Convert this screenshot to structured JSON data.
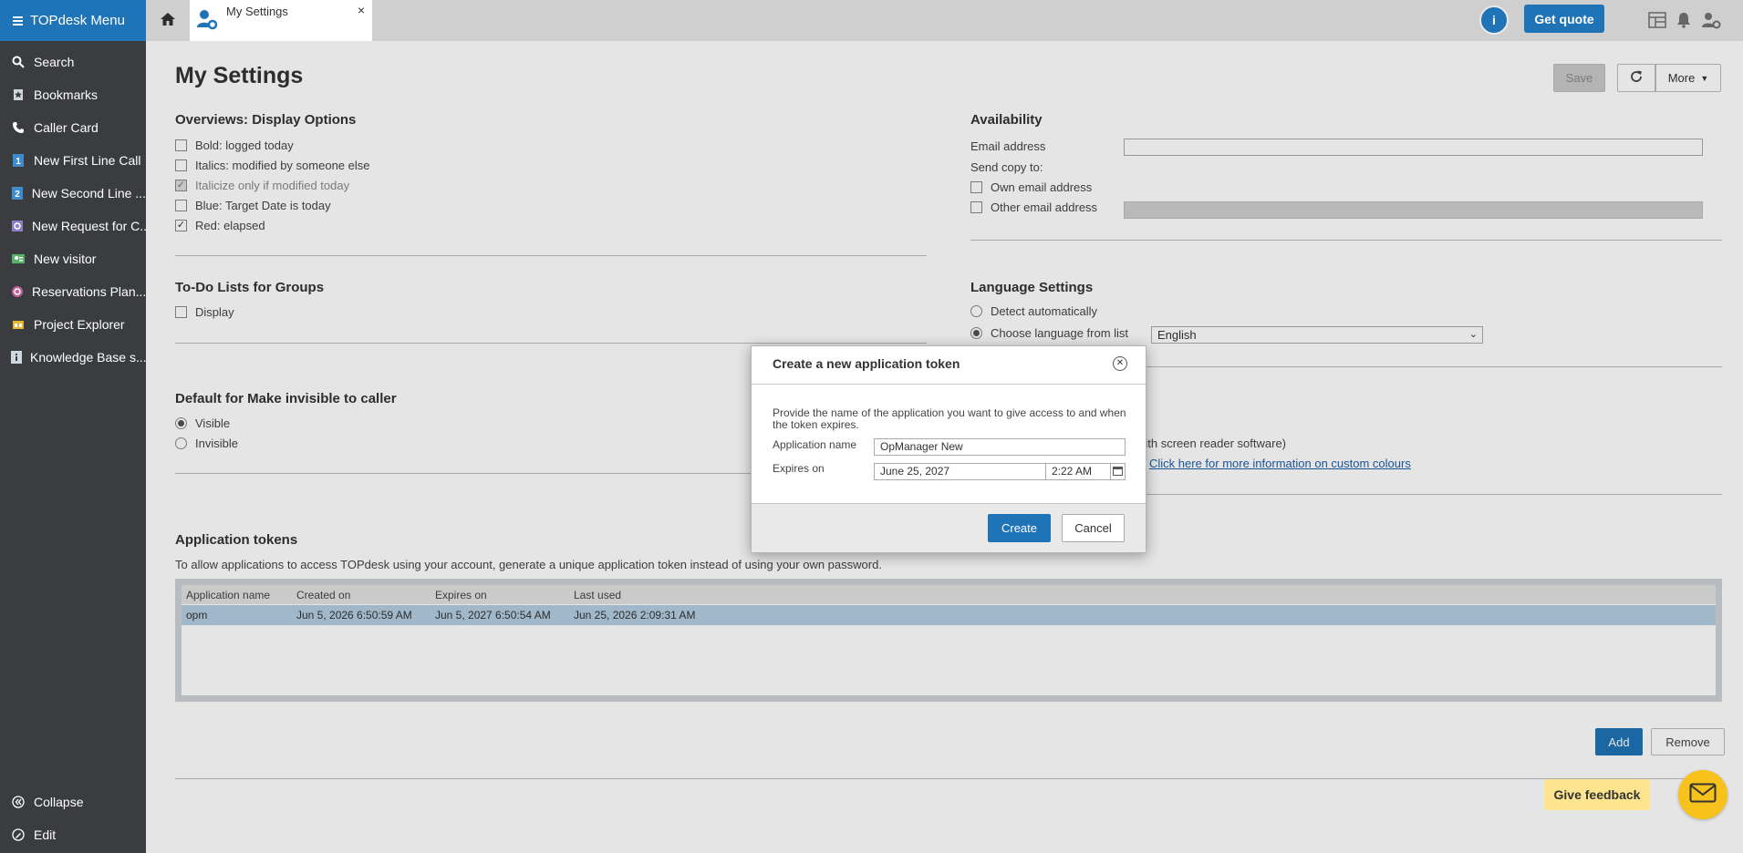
{
  "sidebar": {
    "menu_label": "TOPdesk Menu",
    "items": [
      {
        "label": "Search",
        "icon": "search-icon"
      },
      {
        "label": "Bookmarks",
        "icon": "bookmark-icon"
      },
      {
        "label": "Caller Card",
        "icon": "phone-icon"
      },
      {
        "label": "New First Line Call",
        "icon": "first-line-icon"
      },
      {
        "label": "New Second Line ...",
        "icon": "second-line-icon"
      },
      {
        "label": "New Request for C...",
        "icon": "change-request-icon"
      },
      {
        "label": "New visitor",
        "icon": "visitor-icon"
      },
      {
        "label": "Reservations Plan...",
        "icon": "reservations-icon"
      },
      {
        "label": "Project Explorer",
        "icon": "project-icon"
      },
      {
        "label": "Knowledge Base s...",
        "icon": "knowledge-icon"
      }
    ],
    "bottom": [
      {
        "label": "Collapse",
        "icon": "collapse-icon"
      },
      {
        "label": "Edit",
        "icon": "edit-icon"
      }
    ]
  },
  "topbar": {
    "tab_label": "My Settings",
    "tab_close": "×",
    "info_label": "i",
    "quote_label": "Get quote"
  },
  "page": {
    "title": "My Settings",
    "save_label": "Save",
    "more_label": "More"
  },
  "overviews": {
    "title": "Overviews: Display Options",
    "options": [
      {
        "label": "Bold: logged today",
        "checked": false,
        "disabled": false
      },
      {
        "label": "Italics: modified by someone else",
        "checked": false,
        "disabled": false
      },
      {
        "label": "Italicize only if modified today",
        "checked": true,
        "disabled": true
      },
      {
        "label": "Blue: Target Date is today",
        "checked": false,
        "disabled": false
      },
      {
        "label": "Red: elapsed",
        "checked": true,
        "disabled": false
      }
    ]
  },
  "todo": {
    "title": "To-Do Lists for Groups",
    "display_label": "Display"
  },
  "invisible": {
    "title": "Default for Make invisible to caller",
    "options": [
      "Visible",
      "Invisible"
    ],
    "selected": "Visible"
  },
  "availability": {
    "title": "Availability",
    "email_label": "Email address",
    "email_value": "",
    "send_copy_label": "Send copy to:",
    "own_email_label": "Own email address",
    "other_email_label": "Other email address"
  },
  "language": {
    "title": "Language Settings",
    "detect_label": "Detect automatically",
    "choose_label": "Choose language from list",
    "selected_language": "English"
  },
  "accessibility": {
    "screen_reader_text": "with screen reader software)",
    "custom_colours_link": "Click here for more information on custom colours"
  },
  "tokens": {
    "title": "Application tokens",
    "description": "To allow applications to access TOPdesk using your account, generate a unique application token instead of using your own password.",
    "columns": [
      "Application name",
      "Created on",
      "Expires on",
      "Last used"
    ],
    "rows": [
      [
        "opm",
        "Jun 5, 2026 6:50:59 AM",
        "Jun 5, 2027 6:50:54 AM",
        "Jun 25, 2026 2:09:31 AM"
      ]
    ],
    "add_label": "Add",
    "remove_label": "Remove"
  },
  "dialog": {
    "title": "Create a new application token",
    "description": "Provide the name of the application you want to give access to and when the token expires.",
    "app_name_label": "Application name",
    "app_name_value": "OpManager New",
    "expires_label": "Expires on",
    "expires_date": "June 25, 2027",
    "expires_time": "2:22 AM",
    "create_label": "Create",
    "cancel_label": "Cancel"
  },
  "feedback": {
    "label": "Give feedback"
  },
  "colors": {
    "accent": "#1f73b7",
    "sidebar_bg": "#3a3c3f",
    "feedback_yellow": "#f7c21b",
    "selected_row": "#b3cde0"
  }
}
